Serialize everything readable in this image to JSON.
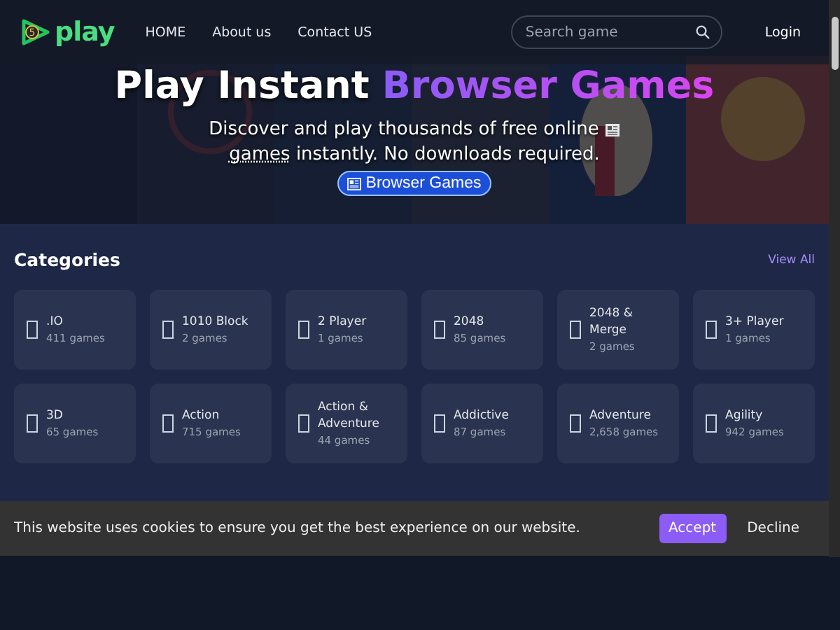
{
  "header": {
    "logo": {
      "badge": "5",
      "text": "play"
    },
    "nav": [
      {
        "label": "HOME"
      },
      {
        "label": "About us"
      },
      {
        "label": "Contact US"
      }
    ],
    "search": {
      "placeholder": "Search game"
    },
    "login": "Login"
  },
  "hero": {
    "kind": "picture",
    "title": {
      "text": "Play Instant",
      "highlight": "Browser Games"
    },
    "subtitle": {
      "before": "Discover and play thousands of free online",
      "underlined": "games",
      "after": "instantly. No downloads required."
    },
    "tag": "Browser Games"
  },
  "categories": {
    "title": "Categories",
    "view_all": "View All",
    "items": [
      {
        "name": ".IO",
        "count": "411 games"
      },
      {
        "name": "1010 Block",
        "count": "2 games"
      },
      {
        "name": "2 Player",
        "count": "1 games"
      },
      {
        "name": "2048",
        "count": "85 games"
      },
      {
        "name": "2048 & Merge",
        "count": "2 games"
      },
      {
        "name": "3+ Player",
        "count": "1 games"
      },
      {
        "name": "3D",
        "count": "65 games"
      },
      {
        "name": "Action",
        "count": "715 games"
      },
      {
        "name": "Action & Adventure",
        "count": "44 games"
      },
      {
        "name": "Addictive",
        "count": "87 games"
      },
      {
        "name": "Adventure",
        "count": "2,658 games"
      },
      {
        "name": "Agility",
        "count": "942 games"
      }
    ]
  },
  "cookie_bar": {
    "message": "This website uses cookies to ensure you get the best experience on our website.",
    "accept": "Accept",
    "decline": "Decline"
  }
}
